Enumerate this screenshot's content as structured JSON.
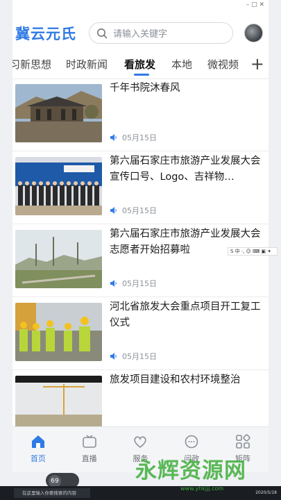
{
  "header": {
    "logo": "冀云元氏",
    "search_placeholder": "请输入关键字"
  },
  "tabs": [
    "习新思想",
    "时政新闻",
    "看旅发",
    "本地",
    "微视频"
  ],
  "active_tab_index": 2,
  "articles": [
    {
      "title": "千年书院沐春风",
      "date": "05月15日"
    },
    {
      "title": "第六届石家庄市旅游产业发展大会宣传口号、Logo、吉祥物…",
      "date": "05月15日"
    },
    {
      "title": "第六届石家庄市旅游产业发展大会志愿者开始招募啦",
      "date": "05月15日"
    },
    {
      "title": "河北省旅发大会重点项目开工复工仪式",
      "date": "05月15日"
    },
    {
      "title": "旅发项目建设和农村环境整治",
      "date": ""
    }
  ],
  "bottom_nav": [
    "首页",
    "直播",
    "服务",
    "问政",
    "矩阵"
  ],
  "active_nav_index": 0,
  "taskbar": {
    "search_placeholder": "在这里输入你要搜索的内容",
    "date": "2020/5/18",
    "widget_value": "69"
  },
  "watermark": {
    "text": "永辉资源网",
    "url": "www.yhkjjj.com"
  },
  "colors": {
    "accent": "#2f7be5"
  }
}
